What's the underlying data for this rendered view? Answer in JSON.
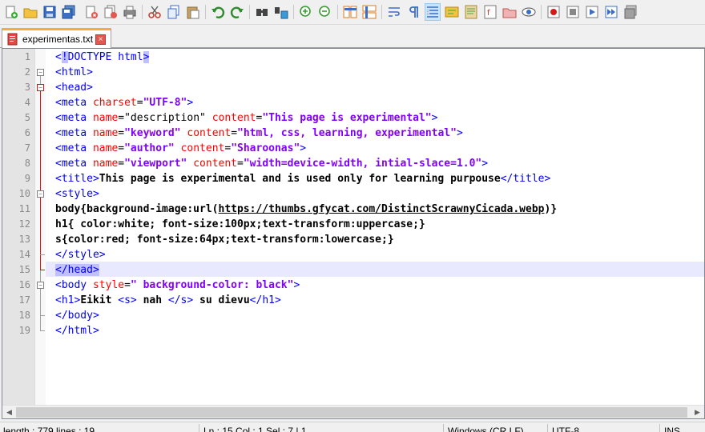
{
  "toolbar": {
    "icons": [
      "new-file-icon",
      "open-file-icon",
      "save-icon",
      "save-all-icon",
      "close-icon",
      "close-all-icon",
      "print-icon",
      "cut-icon",
      "copy-icon",
      "paste-icon",
      "undo-icon",
      "redo-icon",
      "find-icon",
      "replace-icon",
      "zoom-in-icon",
      "zoom-out-icon",
      "sync-vertical-icon",
      "sync-horizontal-icon",
      "word-wrap-icon",
      "show-all-characters-icon",
      "indent-guide-icon",
      "user-defined-language-icon",
      "document-map-icon",
      "function-list-icon",
      "folder-as-workspace-icon",
      "monitoring-icon",
      "record-macro-icon",
      "stop-recording-icon",
      "playback-macro-icon",
      "run-macro-multiple-icon",
      "save-macro-icon"
    ]
  },
  "tab": {
    "label": "experimentas.txt",
    "close": "×"
  },
  "editor": {
    "lines": [
      [
        [
          "t-tag",
          "<"
        ],
        [
          "t-tag t-hl",
          "!"
        ],
        [
          "t-tag",
          "DOCTYPE html"
        ],
        [
          "t-tag t-hl",
          ">"
        ]
      ],
      [
        [
          "t-tag",
          "<html>"
        ]
      ],
      [
        [
          "t-tag",
          "<head>"
        ]
      ],
      [
        [
          "t-tag",
          "<meta "
        ],
        [
          "t-attr",
          "charset"
        ],
        [
          "t-plain",
          "="
        ],
        [
          "t-val",
          "\"UTF-8\""
        ],
        [
          "t-tag",
          ">"
        ]
      ],
      [
        [
          "t-tag",
          "<meta "
        ],
        [
          "t-attr",
          "name"
        ],
        [
          "t-plain",
          "="
        ],
        [
          "t-plain",
          "\"description\" "
        ],
        [
          "t-attr",
          "content"
        ],
        [
          "t-plain",
          "="
        ],
        [
          "t-val",
          "\"This page is experimental\""
        ],
        [
          "t-tag",
          ">"
        ]
      ],
      [
        [
          "t-tag",
          "<meta "
        ],
        [
          "t-attr",
          "name"
        ],
        [
          "t-plain",
          "="
        ],
        [
          "t-val",
          "\"keyword\""
        ],
        [
          "t-plain",
          " "
        ],
        [
          "t-attr",
          "content"
        ],
        [
          "t-plain",
          "="
        ],
        [
          "t-val",
          "\"html, css, learning, experimental\""
        ],
        [
          "t-tag",
          ">"
        ]
      ],
      [
        [
          "t-tag",
          "<meta "
        ],
        [
          "t-attr",
          "name"
        ],
        [
          "t-plain",
          "="
        ],
        [
          "t-val",
          "\"author\""
        ],
        [
          "t-plain",
          " "
        ],
        [
          "t-attr",
          "content"
        ],
        [
          "t-plain",
          "="
        ],
        [
          "t-val",
          "\"Sharoonas\""
        ],
        [
          "t-tag",
          ">"
        ]
      ],
      [
        [
          "t-tag",
          "<meta "
        ],
        [
          "t-attr",
          "name"
        ],
        [
          "t-plain",
          "="
        ],
        [
          "t-val",
          "\"viewport\""
        ],
        [
          "t-plain",
          " "
        ],
        [
          "t-attr",
          "content"
        ],
        [
          "t-plain",
          "="
        ],
        [
          "t-val",
          "\"width=device-width, intial-slace=1.0\""
        ],
        [
          "t-tag",
          ">"
        ]
      ],
      [
        [
          "t-tag",
          "<title>"
        ],
        [
          "t-bold",
          "This page is experimental and is used only for learning purpouse"
        ],
        [
          "t-tag",
          "</title>"
        ]
      ],
      [
        [
          "t-tag",
          "<style>"
        ]
      ],
      [
        [
          "t-bold",
          "body{background-image:url("
        ],
        [
          "t-url",
          "https://thumbs.gfycat.com/DistinctScrawnyCicada.webp"
        ],
        [
          "t-bold",
          ")}"
        ]
      ],
      [
        [
          "t-bold",
          "h1{ color:white; font-size:100px;text-transform:uppercase;}"
        ]
      ],
      [
        [
          "t-bold",
          "s{color:red; font-size:64px;text-transform:lowercase;}"
        ]
      ],
      [
        [
          "t-tag",
          "</style>"
        ]
      ],
      [
        [
          "t-tag t-hl",
          "</head>"
        ]
      ],
      [
        [
          "t-tag",
          "<body "
        ],
        [
          "t-attr",
          "style"
        ],
        [
          "t-plain",
          "="
        ],
        [
          "t-val",
          "\" background-color: black\""
        ],
        [
          "t-tag",
          ">"
        ]
      ],
      [
        [
          "t-tag",
          "<h1>"
        ],
        [
          "t-bold",
          "Eikit "
        ],
        [
          "t-tag",
          "<s>"
        ],
        [
          "t-bold",
          " nah "
        ],
        [
          "t-tag",
          "</s>"
        ],
        [
          "t-bold",
          " su dievu"
        ],
        [
          "t-tag",
          "</h1>"
        ]
      ],
      [
        [
          "t-tag",
          "</body>"
        ]
      ],
      [
        [
          "t-tag",
          "</html>"
        ]
      ]
    ],
    "current_line": 15,
    "fold_markers": {
      "2": "minus",
      "3": "minus",
      "10": "minus",
      "16": "minus"
    }
  },
  "statusbar": {
    "length": "length : 779    lines : 19",
    "position": "Ln : 15    Col : 1    Sel : 7 | 1",
    "eol": "Windows (CR LF)",
    "encoding": "UTF-8",
    "mode": "INS"
  },
  "colors": {
    "tag": "#0000ff",
    "attribute": "#ff0000",
    "value": "#8000ff",
    "current_line": "#e8e8ff",
    "fold_red": "#d81818"
  }
}
